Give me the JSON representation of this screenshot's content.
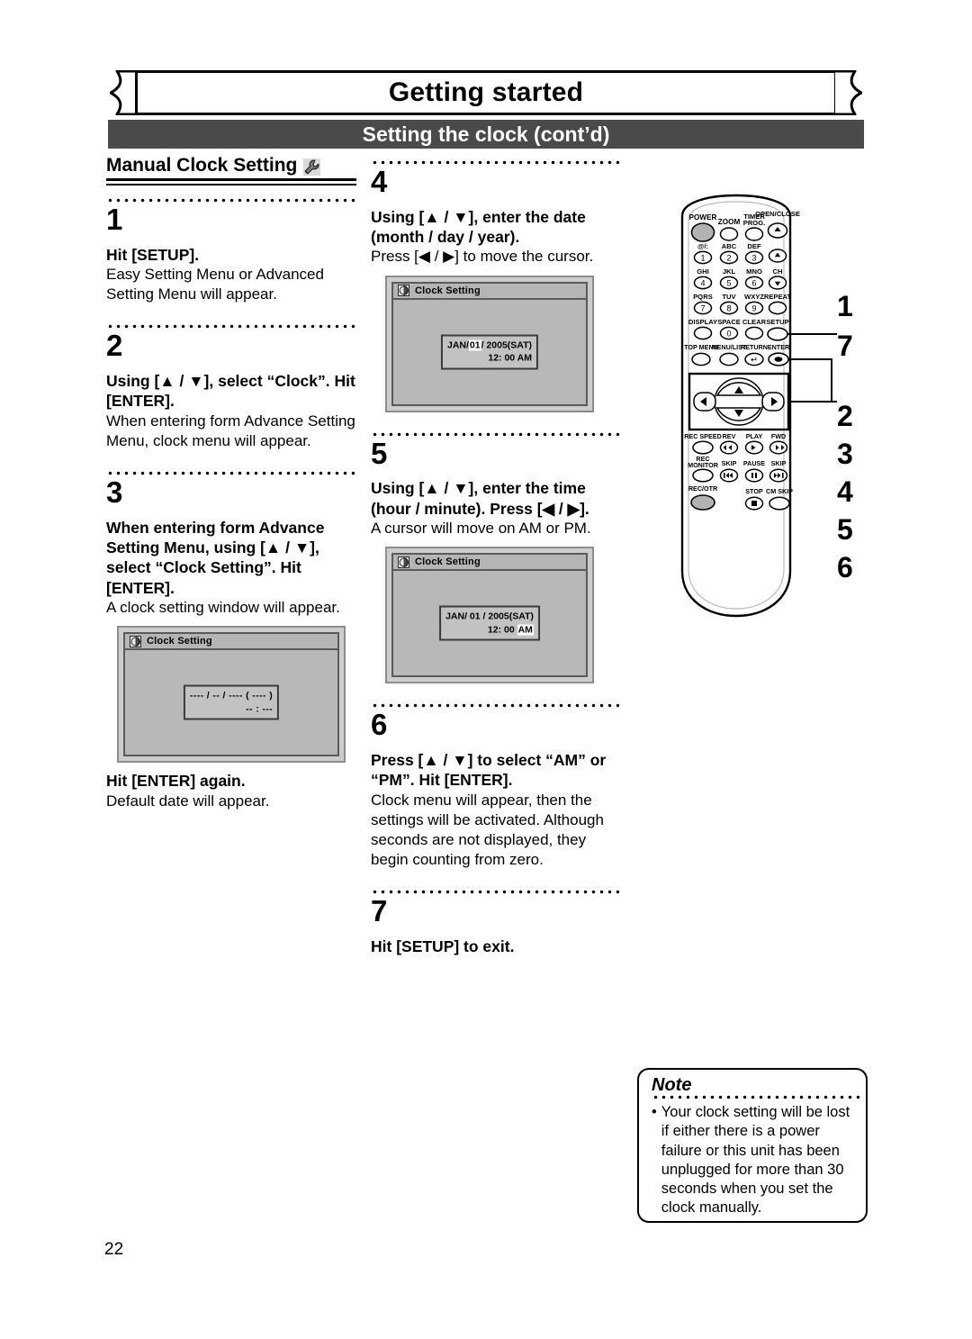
{
  "header": {
    "banner_title": "Getting started",
    "section_title": "Setting the clock (cont’d)"
  },
  "left_column": {
    "subhead": "Manual Clock Setting",
    "subhead_icon": "wrench-icon",
    "steps": [
      {
        "number": "1",
        "bold": "Hit [SETUP].",
        "body": "Easy Setting Menu or Advanced Setting Menu will appear."
      },
      {
        "number": "2",
        "bold_pre": "Using [",
        "bold_mid": "], select “Clock”. Hit [ENTER].",
        "bold": "Using [▲ / ▼], select “Clock”. Hit [ENTER].",
        "body": "When entering form Advance Setting Menu, clock menu will appear."
      },
      {
        "number": "3",
        "bold": "When entering form Advance Setting Menu, using [▲ / ▼], select “Clock Setting”. Hit [ENTER].",
        "body": "A clock setting window will appear.",
        "osd": {
          "title": "Clock Setting",
          "icon": "clock-icon",
          "line1": "---- / -- / ---- ( ---- )",
          "line2": "-- : ---"
        },
        "after_bold": "Hit [ENTER] again.",
        "after_body": "Default date will appear."
      }
    ]
  },
  "mid_column": {
    "steps": [
      {
        "number": "4",
        "bold": "Using [▲ / ▼], enter the date (month / day / year).",
        "body": "Press [◀ / ▶] to move the cursor.",
        "osd": {
          "title": "Clock Setting",
          "icon": "clock-icon",
          "date_pre": "JAN/",
          "date_hl": "01",
          "date_post": "/ 2005(SAT)",
          "time_pre": "12: 00",
          "time_hl": "",
          "time_post": "AM"
        }
      },
      {
        "number": "5",
        "bold": "Using [▲ / ▼], enter the time (hour / minute). Press [◀ / ▶].",
        "body": "A cursor will move on AM or PM.",
        "osd": {
          "title": "Clock Setting",
          "icon": "clock-icon",
          "date_pre": "JAN/ 01",
          "date_hl": "",
          "date_post": "/ 2005(SAT)",
          "time_pre": "12: 00",
          "time_hl": "AM",
          "time_post": ""
        }
      },
      {
        "number": "6",
        "bold": "Press [▲ / ▼] to select “AM” or “PM”. Hit [ENTER].",
        "body": "Clock menu will appear, then the settings will be activated. Although seconds are not displayed, they begin counting from zero."
      },
      {
        "number": "7",
        "bold": "Hit [SETUP] to exit.",
        "body": ""
      }
    ]
  },
  "remote": {
    "label": "remote-control-illustration",
    "buttons": {
      "power": "POWER",
      "zoom": "ZOOM",
      "timer_prog_1": "TIMER",
      "timer_prog_2": "PROG.",
      "open_close": "OPEN/CLOSE",
      "k1_label": "@/:",
      "k1": "1",
      "k2_label": "ABC",
      "k2": "2",
      "k3_label": "DEF",
      "k3": "3",
      "k4_label": "GHI",
      "k4": "4",
      "k5_label": "JKL",
      "k5": "5",
      "k6_label": "MNO",
      "k6": "6",
      "ch": "CH",
      "k7_label": "PQRS",
      "k7": "7",
      "k8_label": "TUV",
      "k8": "8",
      "k9_label": "WXYZ",
      "k9": "9",
      "repeat": "REPEAT",
      "display": "DISPLAY",
      "space": "SPACE",
      "k0": "0",
      "clear": "CLEAR",
      "setup": "SETUP",
      "top_menu": "TOP MENU",
      "menu_list": "MENU/LIST",
      "return": "RETURN",
      "enter": "ENTER",
      "rec_speed": "REC SPEED",
      "rev": "REV",
      "play": "PLAY",
      "fwd": "FWD",
      "rec_monitor_1": "REC",
      "rec_monitor_2": "MONITOR",
      "skip_l": "SKIP",
      "pause": "PAUSE",
      "skip_r": "SKIP",
      "rec_otr": "REC/OTR",
      "stop": "STOP",
      "cm_skip": "CM SKIP"
    },
    "callouts": [
      "1",
      "7",
      "2",
      "3",
      "4",
      "5",
      "6"
    ]
  },
  "note": {
    "title": "Note",
    "bullet": "•",
    "text": "Your clock setting will be lost if either there is a power failure or this unit has been unplugged for more than 30 seconds when you set the clock manually."
  },
  "footer": {
    "page_number": "22"
  },
  "colors": {
    "section_bar": "#4a4a4a",
    "osd_bg": "#b8b8b8",
    "osd_title_bg": "#b5b5b5",
    "highlight": "#ffffff"
  }
}
